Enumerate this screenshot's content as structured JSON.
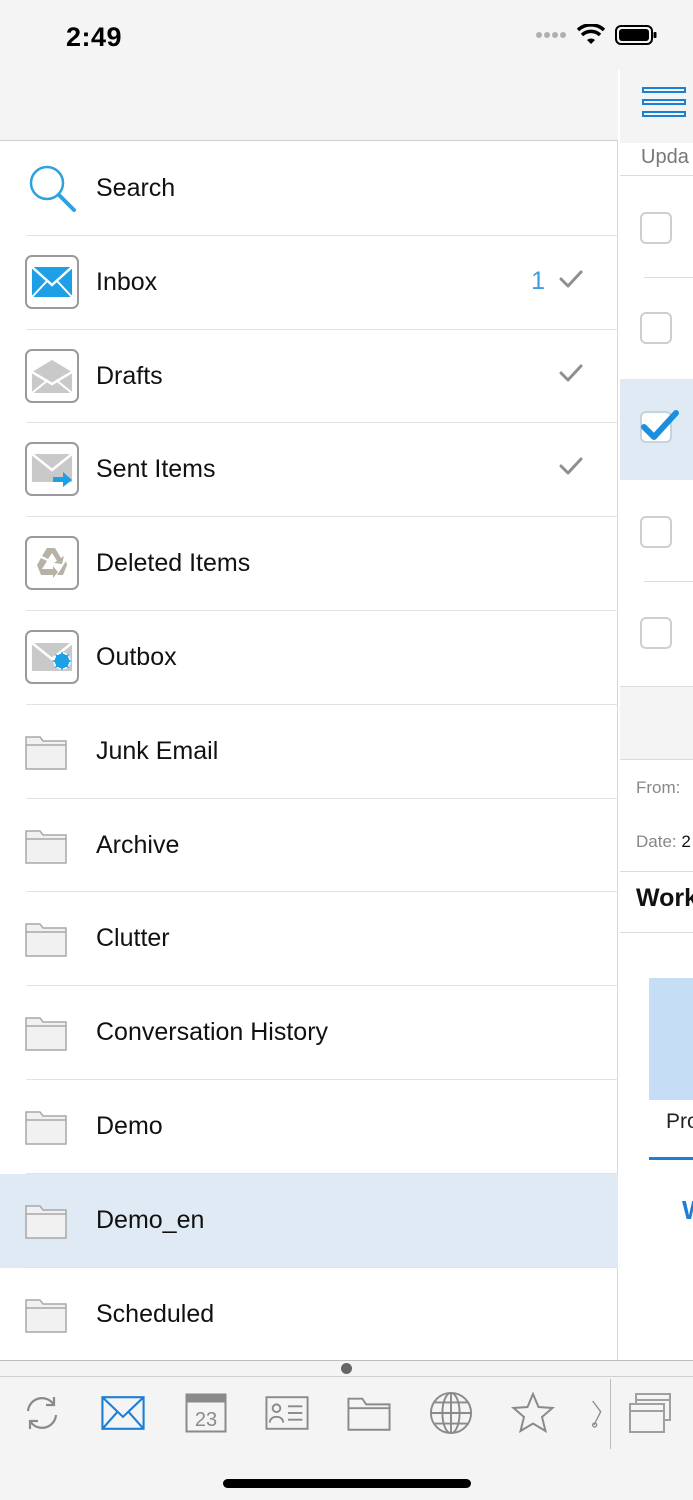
{
  "status_bar": {
    "time": "2:49"
  },
  "folders": [
    {
      "label": "Search",
      "icon": "search-icon",
      "count": "",
      "checked": false
    },
    {
      "label": "Inbox",
      "icon": "inbox-icon",
      "count": "1",
      "checked": true
    },
    {
      "label": "Drafts",
      "icon": "drafts-icon",
      "count": "",
      "checked": true
    },
    {
      "label": "Sent Items",
      "icon": "sent-items-icon",
      "count": "",
      "checked": true
    },
    {
      "label": "Deleted Items",
      "icon": "recycle-icon",
      "count": "",
      "checked": false
    },
    {
      "label": "Outbox",
      "icon": "outbox-icon",
      "count": "",
      "checked": false
    },
    {
      "label": "Junk Email",
      "icon": "folder-icon",
      "count": "",
      "checked": false
    },
    {
      "label": "Archive",
      "icon": "folder-icon",
      "count": "",
      "checked": false
    },
    {
      "label": "Clutter",
      "icon": "folder-icon",
      "count": "",
      "checked": false
    },
    {
      "label": "Conversation History",
      "icon": "folder-icon",
      "count": "",
      "checked": false
    },
    {
      "label": "Demo",
      "icon": "folder-icon",
      "count": "",
      "checked": false
    },
    {
      "label": "Demo_en",
      "icon": "folder-icon",
      "count": "",
      "checked": false,
      "selected": true
    },
    {
      "label": "Scheduled",
      "icon": "folder-icon",
      "count": "",
      "checked": false
    }
  ],
  "right_pane": {
    "updated_text": "Upda",
    "from_label": "From:",
    "date_label": "Date:",
    "date_value": "2",
    "subject": "Work",
    "tab_label": "Pro",
    "link_letter": "W"
  },
  "toolbar": {
    "calendar_day": "23",
    "tools": [
      "sync-icon",
      "mail-icon",
      "calendar-icon",
      "contacts-icon",
      "folder-icon",
      "globe-icon",
      "star-icon",
      "tools-icon",
      "windows-icon"
    ]
  },
  "colors": {
    "accent": "#1a7fd6",
    "selected_row": "#dfeaf4",
    "count": "#3a9ee0"
  }
}
